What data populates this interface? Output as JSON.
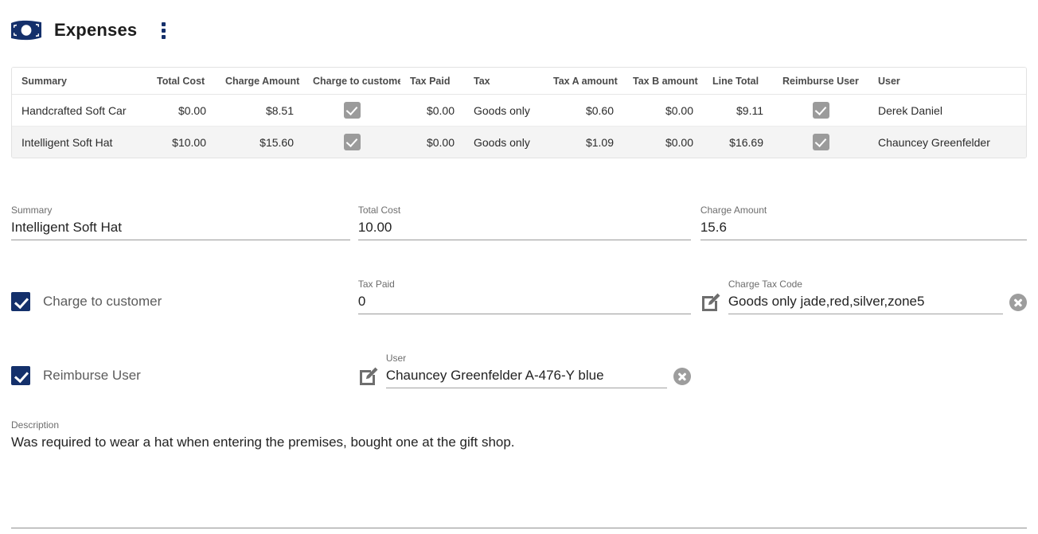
{
  "header": {
    "title": "Expenses",
    "brand_icon": "banknote-icon",
    "menu_icon": "kebab-menu-icon"
  },
  "grid": {
    "columns": [
      "Summary",
      "Total Cost",
      "Charge Amount",
      "Charge to customer",
      "Tax Paid",
      "Tax",
      "Tax A amount",
      "Tax B amount",
      "Line Total",
      "Reimburse User",
      "User"
    ],
    "rows": [
      {
        "summary": "Handcrafted Soft Car",
        "total_cost": "$0.00",
        "charge_amount": "$8.51",
        "charge_to_customer": true,
        "tax_paid": "$0.00",
        "tax": "Goods only",
        "tax_a_amount": "$0.60",
        "tax_b_amount": "$0.00",
        "line_total": "$9.11",
        "reimburse_user": true,
        "user": "Derek Daniel",
        "selected": false
      },
      {
        "summary": "Intelligent Soft Hat",
        "total_cost": "$10.00",
        "charge_amount": "$15.60",
        "charge_to_customer": true,
        "tax_paid": "$0.00",
        "tax": "Goods only",
        "tax_a_amount": "$1.09",
        "tax_b_amount": "$0.00",
        "line_total": "$16.69",
        "reimburse_user": true,
        "user": "Chauncey Greenfelder",
        "selected": true
      }
    ]
  },
  "form": {
    "summary": {
      "label": "Summary",
      "value": "Intelligent Soft Hat"
    },
    "total_cost": {
      "label": "Total Cost",
      "value": "10.00"
    },
    "charge_amount": {
      "label": "Charge Amount",
      "value": "15.6"
    },
    "charge_to_customer": {
      "label": "Charge to customer",
      "checked": true
    },
    "tax_paid": {
      "label": "Tax Paid",
      "value": "0"
    },
    "charge_tax_code": {
      "label": "Charge Tax Code",
      "value": "Goods only jade,red,silver,zone5",
      "edit_icon": "edit-pencil-icon",
      "clear_icon": "clear-circle-icon"
    },
    "reimburse_user": {
      "label": "Reimburse User",
      "checked": true
    },
    "user": {
      "label": "User",
      "value": "Chauncey Greenfelder A-476-Y blue",
      "edit_icon": "edit-pencil-icon",
      "clear_icon": "clear-circle-icon"
    },
    "description": {
      "label": "Description",
      "value": "Was required to wear a hat when entering the premises, bought one at the gift shop."
    }
  },
  "colors": {
    "brand": "#14306b",
    "checkbox_checked": "#14306b",
    "checkbox_readonly": "#9b9b9b",
    "row_selected": "#f4f4f4",
    "underline": "#9a9a9a"
  }
}
